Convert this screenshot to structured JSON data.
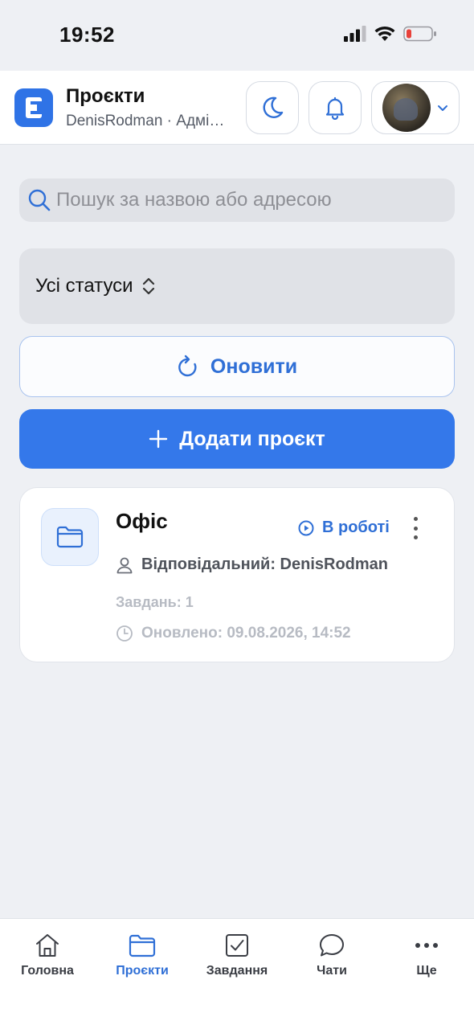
{
  "status_bar": {
    "time": "19:52"
  },
  "header": {
    "title": "Проєкти",
    "subtitle": "DenisRodman · Адміністратор",
    "logo_letter": "E"
  },
  "search": {
    "placeholder": "Пошук за назвою або адресою",
    "value": ""
  },
  "filter": {
    "selected": "Усі статуси"
  },
  "buttons": {
    "refresh": "Оновити",
    "add_project": "Додати проєкт"
  },
  "projects": [
    {
      "name": "Офіс",
      "status": "В роботі",
      "responsible": "Відповідальний: DenisRodman",
      "tasks": "Завдань: 1",
      "updated": "Оновлено: 09.08.2026, 14:52"
    }
  ],
  "nav": [
    {
      "label": "Головна",
      "icon": "home-icon"
    },
    {
      "label": "Проєкти",
      "icon": "folder-icon",
      "active": true
    },
    {
      "label": "Завдання",
      "icon": "checkbox-icon"
    },
    {
      "label": "Чати",
      "icon": "chat-icon"
    },
    {
      "label": "Ще",
      "icon": "more-dots-icon"
    }
  ],
  "colors": {
    "accent": "#3478ea",
    "accent_text": "#2f6fd6",
    "background": "#eef0f4"
  }
}
